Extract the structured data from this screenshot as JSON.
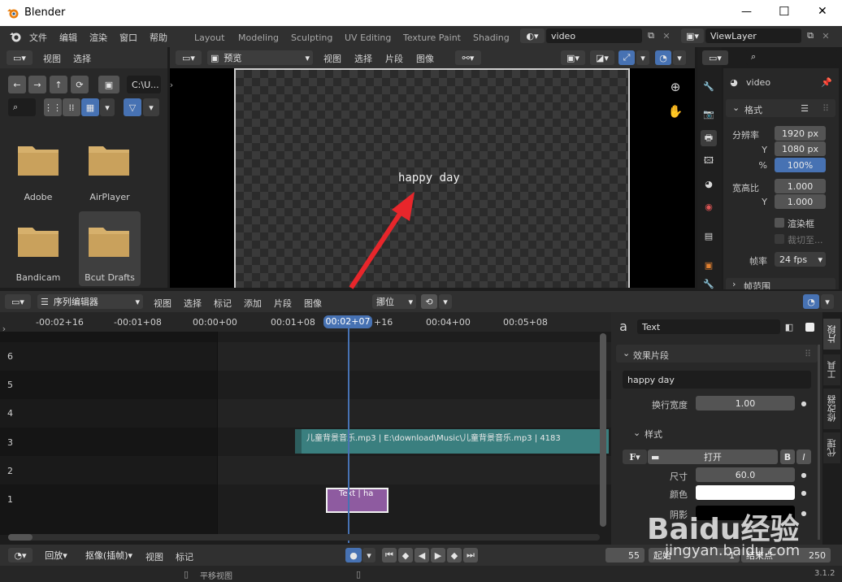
{
  "window": {
    "title": "Blender",
    "minimize": "—",
    "maximize": "☐",
    "close": "✕"
  },
  "topmenu": {
    "items": [
      "文件",
      "编辑",
      "渲染",
      "窗口",
      "帮助"
    ]
  },
  "workspaces": [
    "Layout",
    "Modeling",
    "Sculpting",
    "UV Editing",
    "Texture Paint",
    "Shading"
  ],
  "scene": {
    "name": "video",
    "viewlayer": "ViewLayer"
  },
  "filebrowser": {
    "menu": [
      "视图",
      "选择"
    ],
    "path": "C:\\U...",
    "items": [
      {
        "name": "Adobe"
      },
      {
        "name": "AirPlayer"
      },
      {
        "name": "Bandicam"
      },
      {
        "name": "Bcut Drafts"
      }
    ]
  },
  "preview": {
    "mode": "预览",
    "menu": [
      "视图",
      "选择",
      "片段",
      "图像"
    ],
    "text": "happy day"
  },
  "props": {
    "object": "video",
    "panel": "格式",
    "res_label": "分辨率",
    "res_x": "1920 px",
    "y": "Y",
    "res_y": "1080 px",
    "pct": "%",
    "pct_val": "100%",
    "aspect_label": "宽高比",
    "aspect_x": "1.000",
    "aspect_y": "1.000",
    "border": "渲染框",
    "crop": "裁切至...",
    "fps_label": "帧率",
    "fps": "24 fps",
    "frame_range": "帧范围"
  },
  "seq": {
    "editor": "序列编辑器",
    "menu": [
      "视图",
      "选择",
      "标记",
      "添加",
      "片段",
      "图像"
    ],
    "overlap": "挪位",
    "timecodes": [
      "-00:02+16",
      "-00:01+08",
      "00:00+00",
      "00:01+08",
      "00:02+07",
      "+16",
      "00:04+00",
      "00:05+08"
    ],
    "channels": [
      "6",
      "5",
      "4",
      "3",
      "2",
      "1"
    ],
    "audio_strip": "儿童背景音乐.mp3 | E:\\download\\Music\\儿童背景音乐.mp3 | 4183",
    "text_strip": "Text | ha"
  },
  "side": {
    "strip_name": "Text",
    "effect_panel": "效果片段",
    "text_value": "happy day",
    "wrap_label": "换行宽度",
    "wrap": "1.00",
    "style_panel": "样式",
    "font_open": "打开",
    "size_label": "尺寸",
    "size": "60.0",
    "color_label": "颜色",
    "shadow_label": "阴影",
    "tabs": [
      "片段",
      "工具",
      "修改器",
      "代理"
    ]
  },
  "playback": {
    "menu": [
      "回放",
      "抠像(插帧)",
      "视图",
      "标记"
    ],
    "frame": "55",
    "start_label": "起始",
    "start": "1",
    "end_label": "结束点",
    "end": "250"
  },
  "status": {
    "pan": "平移视图",
    "version": "3.1.2"
  },
  "watermark": {
    "line1": "Baidu经验",
    "line2": "jingyan.baidu.com"
  },
  "colors": {
    "accent": "#4772b3",
    "audio": "#3a7f7f",
    "text_strip": "#8e5ba0",
    "playhead": "#4772b3"
  }
}
